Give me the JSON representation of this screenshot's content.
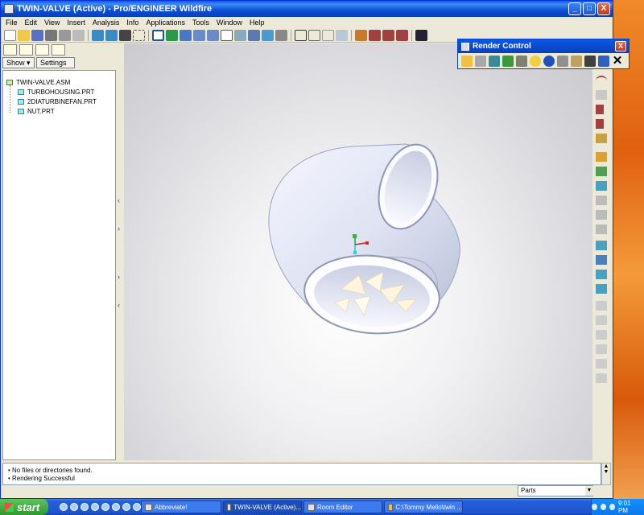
{
  "window": {
    "title": "TWIN-VALVE (Active) - Pro/ENGINEER Wildfire",
    "controls": [
      "_",
      "□",
      "X"
    ]
  },
  "menu": [
    "File",
    "Edit",
    "View",
    "Insert",
    "Analysis",
    "Info",
    "Applications",
    "Tools",
    "Window",
    "Help"
  ],
  "left_panel": {
    "show_label": "Show",
    "settings_label": "Settings",
    "tree": [
      {
        "label": "TWIN-VALVE.ASM"
      },
      {
        "label": "TURBOHOUSING.PRT"
      },
      {
        "label": "2DIATURBINEFAN.PRT"
      },
      {
        "label": "NUT.PRT"
      }
    ]
  },
  "render_control": {
    "title": "Render Control",
    "close_label": "X",
    "clear_label": "✕"
  },
  "messages": [
    "No files or directories found.",
    "Rendering Successful"
  ],
  "filter": {
    "value": "Parts"
  },
  "taskbar": {
    "start_label": "start",
    "tasks": [
      "Abbreviate!",
      "TWIN-VALVE (Active)...",
      "Room Editor",
      "C:\\Tommy Mello\\twin ..."
    ],
    "clock": "9:01 PM"
  },
  "colors": {
    "title_blue": "#0a4fd6",
    "taskbar_blue": "#245edb",
    "start_green": "#2e9a2e",
    "desktop_orange": "#e06010"
  }
}
